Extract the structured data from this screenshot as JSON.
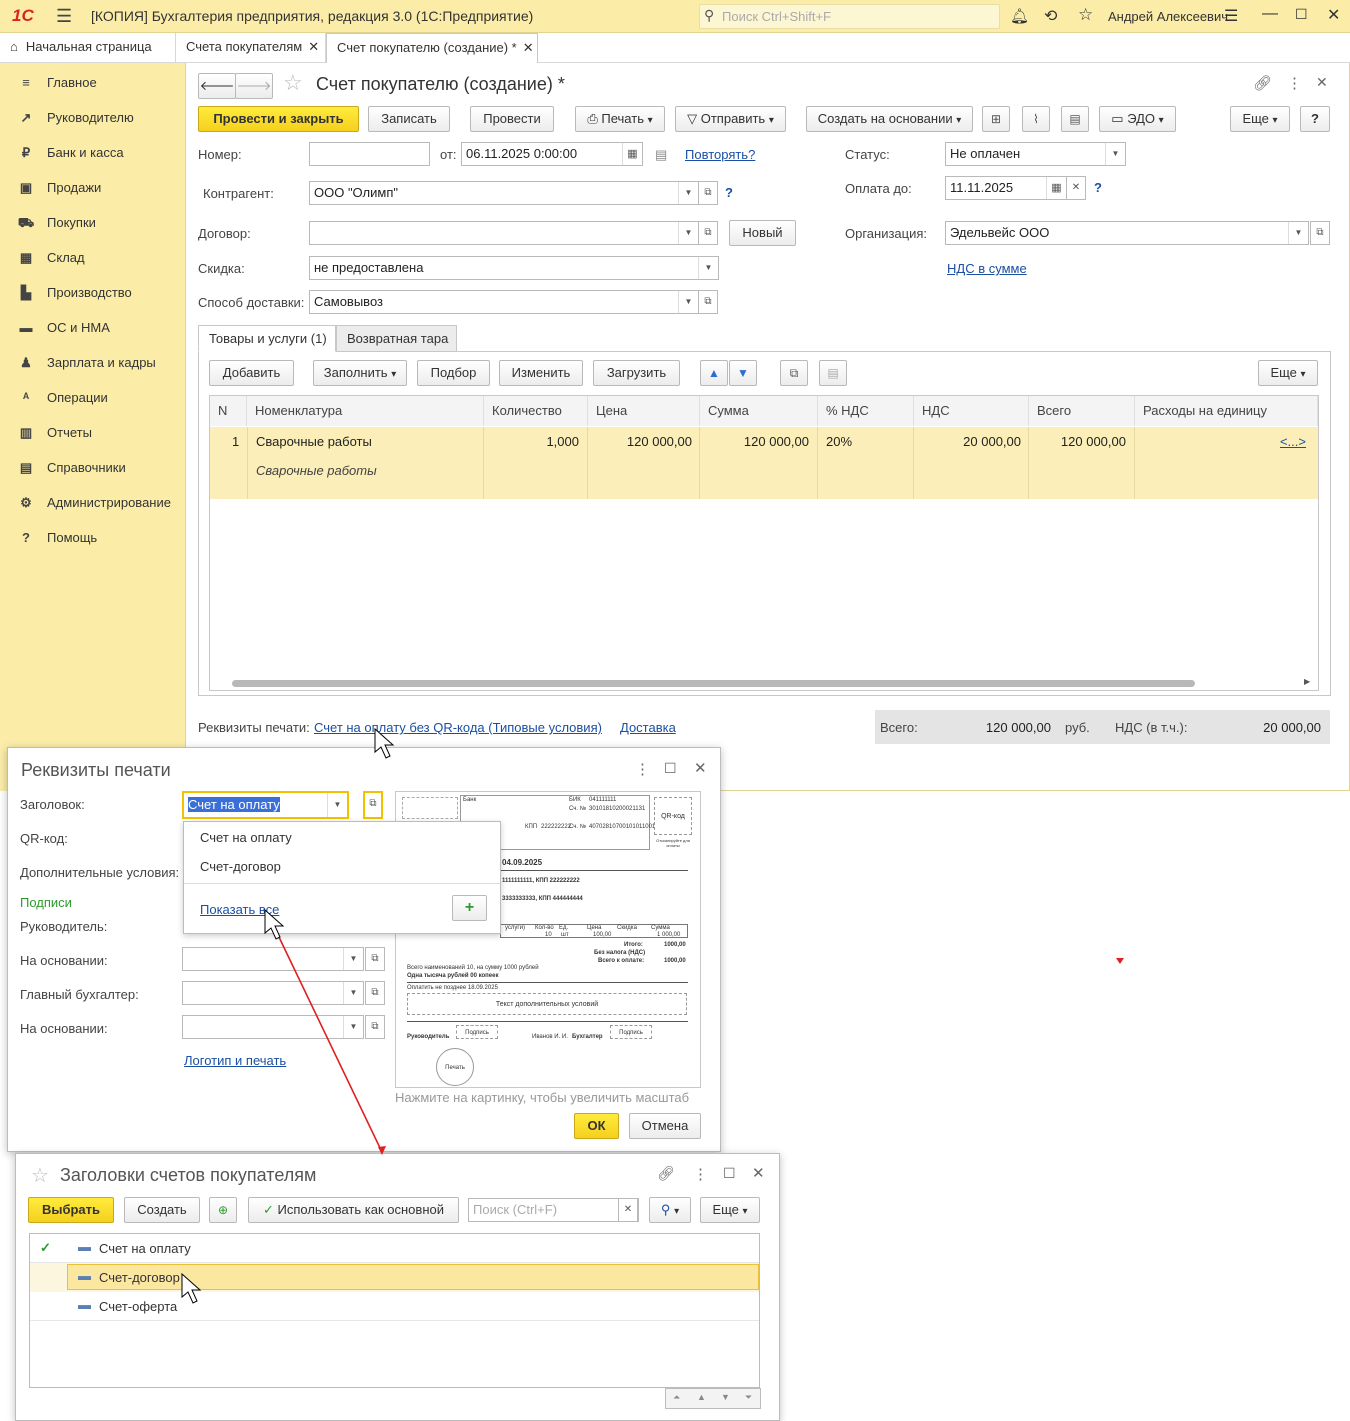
{
  "app": {
    "logo": "1С",
    "title": "[КОПИЯ] Бухгалтерия предприятия, редакция 3.0  (1С:Предприятие)",
    "search_placeholder": "Поиск Ctrl+Shift+F",
    "user": "Андрей Алексеевич"
  },
  "tabs": [
    "Начальная страница",
    "Счета покупателям",
    "Счет покупателю (создание) *"
  ],
  "sidebar": [
    "Главное",
    "Руководителю",
    "Банк и касса",
    "Продажи",
    "Покупки",
    "Склад",
    "Производство",
    "ОС и НМА",
    "Зарплата и кадры",
    "Операции",
    "Отчеты",
    "Справочники",
    "Администрирование",
    "Помощь"
  ],
  "doc": {
    "title": "Счет покупателю (создание) *",
    "toolbar": {
      "post_close": "Провести и закрыть",
      "save": "Записать",
      "post": "Провести",
      "print": "Печать",
      "send": "Отправить",
      "create_based": "Создать на основании",
      "edo": "ЭДО",
      "more": "Еще",
      "help": "?"
    },
    "fields": {
      "number_label": "Номер:",
      "number_value": "",
      "from_label": "от:",
      "date_value": "06.11.2025  0:00:00",
      "repeat": "Повторять?",
      "status_label": "Статус:",
      "status_value": "Не оплачен",
      "pay_label": "Оплата до:",
      "pay_value": "11.11.2025",
      "counterparty_label": "Контрагент:",
      "counterparty_value": "ООО \"Олимп\"",
      "contract_label": "Договор:",
      "contract_value": "",
      "new_btn": "Новый",
      "org_label": "Организация:",
      "org_value": "Эдельвейс ООО",
      "vat_link": "НДС в сумме",
      "discount_label": "Скидка:",
      "discount_value": "не предоставлена",
      "delivery_label": "Способ доставки:",
      "delivery_value": "Самовывоз"
    },
    "subtabs": [
      "Товары и услуги (1)",
      "Возвратная тара"
    ],
    "table_toolbar": {
      "add": "Добавить",
      "fill": "Заполнить",
      "select": "Подбор",
      "change": "Изменить",
      "load": "Загрузить",
      "more": "Еще"
    },
    "columns": [
      "N",
      "Номенклатура",
      "Количество",
      "Цена",
      "Сумма",
      "% НДС",
      "НДС",
      "Всего",
      "Расходы на единицу"
    ],
    "rows": [
      {
        "n": "1",
        "name": "Сварочные работы",
        "desc": "Сварочные работы",
        "qty": "1,000",
        "price": "120 000,00",
        "sum": "120 000,00",
        "vat_rate": "20%",
        "vat": "20 000,00",
        "total": "120 000,00",
        "exp": "<...>"
      }
    ],
    "footer": {
      "print_label": "Реквизиты печати:",
      "print_link": "Счет на оплату без QR-кода (Типовые условия)",
      "delivery_link": "Доставка",
      "total_label": "Всего:",
      "total_value": "120 000,00",
      "currency": "руб.",
      "vat_label": "НДС (в т.ч.):",
      "vat_value": "20 000,00"
    }
  },
  "print_dlg": {
    "title": "Реквизиты печати",
    "header_label": "Заголовок:",
    "header_value": "Счет на оплату",
    "qr_label": "QR-код:",
    "addcond_label": "Дополнительные условия:",
    "signatures": "Подписи",
    "head_label": "Руководитель:",
    "basis1_label": "На основании:",
    "chief_label": "Главный бухгалтер:",
    "basis2_label": "На основании:",
    "logo_link": "Логотип и печать",
    "dropdown": {
      "items": [
        "Счет на оплату",
        "Счет-договор"
      ],
      "show_all": "Показать все"
    },
    "preview": {
      "bank": "Банк",
      "bik": "БИК",
      "bik_val": "041111111",
      "acc": "Сч. №",
      "acc_val": "30101810200021131",
      "kpp": "КПП",
      "kpp_val": "222222222",
      "acc2_val": "40702810700101011001",
      "qr": "QR-код",
      "qr_note": "Отсканируйте для оплаты",
      "date": "04.09.2025",
      "inn1": "1111111111, КПП 222222222",
      "inn2": "3333333333, КПП 444444444",
      "cols": [
        "услуги)",
        "Кол-во",
        "Ед.",
        "Цена",
        "Скидка",
        "Сумма"
      ],
      "row": [
        "10",
        "шт",
        "100,00",
        "",
        "1 000,00"
      ],
      "sum_label": "Итого:",
      "sum_val": "1000,00",
      "novat": "Без налога (НДС)",
      "novat_val": "",
      "topay": "Всего к оплате:",
      "topay_val": "1000,00",
      "words1": "Всего наименований 10, на сумму 1000 рублей",
      "words2": "Одна тысяча рублей 00 копеек",
      "due": "Оплатить не позднее 18.09.2025",
      "addtext": "Текст дополнительных условий",
      "head": "Руководитель",
      "sign": "Подпись",
      "name": "Иванов И. И.",
      "acc_sign": "Бухгалтер",
      "stamp": "Печать"
    },
    "hint": "Нажмите на картинку, чтобы увеличить масштаб",
    "ok": "ОК",
    "cancel": "Отмена"
  },
  "headers_dlg": {
    "title": "Заголовки счетов покупателям",
    "choose": "Выбрать",
    "create": "Создать",
    "use_main": "Использовать как основной",
    "search_placeholder": "Поиск (Ctrl+F)",
    "more": "Еще",
    "items": [
      "Счет на оплату",
      "Счет-договор",
      "Счет-оферта"
    ]
  },
  "colors": {
    "accent_yellow": "#fbeda8",
    "button_yellow": "#f5d01e",
    "link": "#1a4fa3",
    "arrow": "#e02020",
    "green": "#2e9a2e"
  }
}
